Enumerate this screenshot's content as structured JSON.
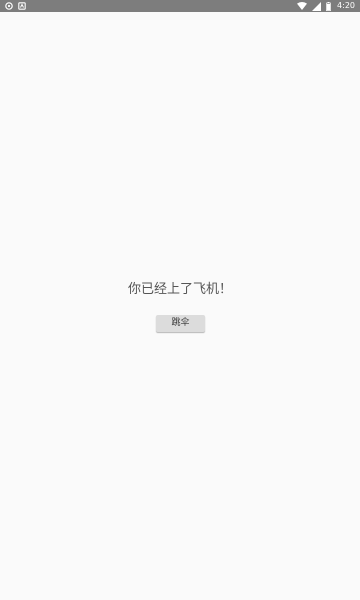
{
  "status_bar": {
    "time": "4:20",
    "left_icons": [
      "notification-app-icon",
      "notification-box-icon"
    ],
    "right_icons": [
      "wifi-icon",
      "signal-icon",
      "battery-icon"
    ]
  },
  "main": {
    "message": "你已经上了飞机！",
    "button_label": "跳伞"
  },
  "colors": {
    "status_bar_bg": "#7d7d7d",
    "background": "#fafafa",
    "button_bg": "#dcdcdc",
    "message_text": "#555555"
  }
}
